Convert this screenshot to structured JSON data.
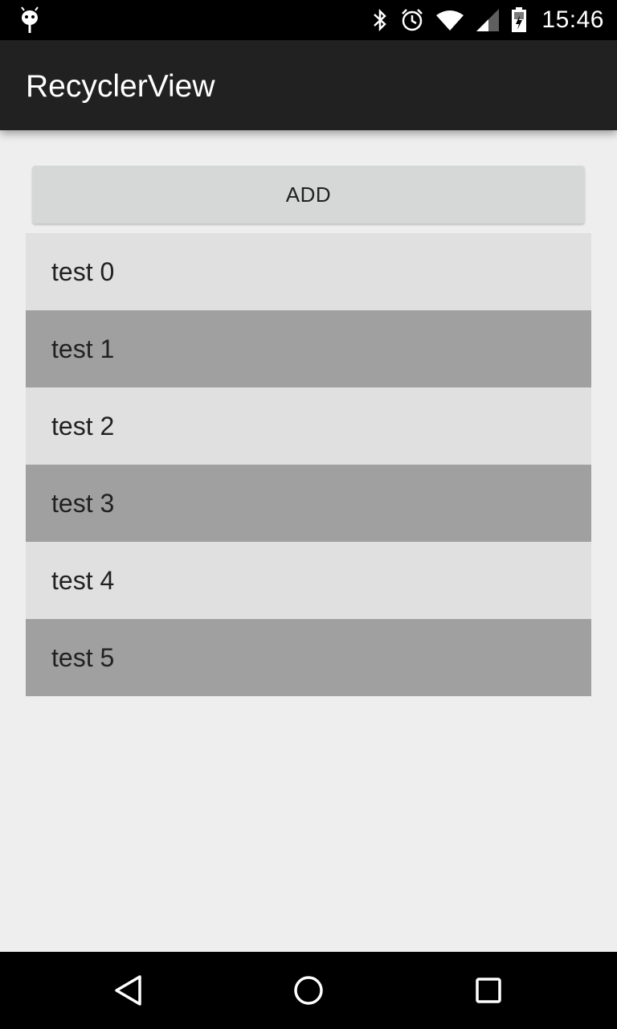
{
  "status_bar": {
    "time": "15:46",
    "icons": [
      "android-debug-icon",
      "bluetooth-icon",
      "alarm-icon",
      "wifi-icon",
      "signal-icon",
      "battery-icon"
    ]
  },
  "app_bar": {
    "title": "RecyclerView"
  },
  "add_button": {
    "label": "ADD"
  },
  "list": {
    "items": [
      {
        "label": "test 0"
      },
      {
        "label": "test 1"
      },
      {
        "label": "test 2"
      },
      {
        "label": "test 3"
      },
      {
        "label": "test 4"
      },
      {
        "label": "test 5"
      }
    ]
  },
  "nav_bar": {
    "icons": [
      "back-icon",
      "home-icon",
      "recents-icon"
    ]
  },
  "colors": {
    "status_bar": "#000000",
    "app_bar": "#212121",
    "background": "#eeeeee",
    "button": "#d6d7d7",
    "row_light": "#e0e0e0",
    "row_dark": "#a0a0a0"
  }
}
